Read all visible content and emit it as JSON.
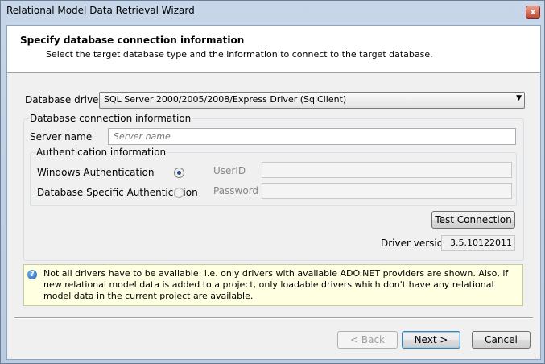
{
  "window": {
    "title": "Relational Model Data Retrieval Wizard",
    "close_glyph": "x"
  },
  "header": {
    "title": "Specify database connection information",
    "subtitle": "Select the target database type and the information to connect to the target database."
  },
  "driver": {
    "label": "Database driver",
    "selected": "SQL Server 2000/2005/2008/Express Driver (SqlClient)"
  },
  "connection": {
    "group_label": "Database connection information",
    "server_label": "Server name",
    "server_placeholder": "Server name",
    "auth": {
      "group_label": "Authentication information",
      "windows_label": "Windows Authentication",
      "windows_checked": true,
      "db_label": "Database Specific Authentication",
      "db_checked": false,
      "userid_label": "UserID",
      "password_label": "Password"
    },
    "test_button": "Test Connection",
    "driver_version_label": "Driver version",
    "driver_version": "3.5.10122011"
  },
  "info": {
    "icon": "question-icon",
    "text": "Not all drivers have to be available: i.e. only drivers with available ADO.NET providers are shown. Also, if new relational model data is added to a project, only loadable drivers which don't have any relational model data in the current project are available."
  },
  "buttons": {
    "back": "< Back",
    "next": "Next >",
    "cancel": "Cancel"
  }
}
